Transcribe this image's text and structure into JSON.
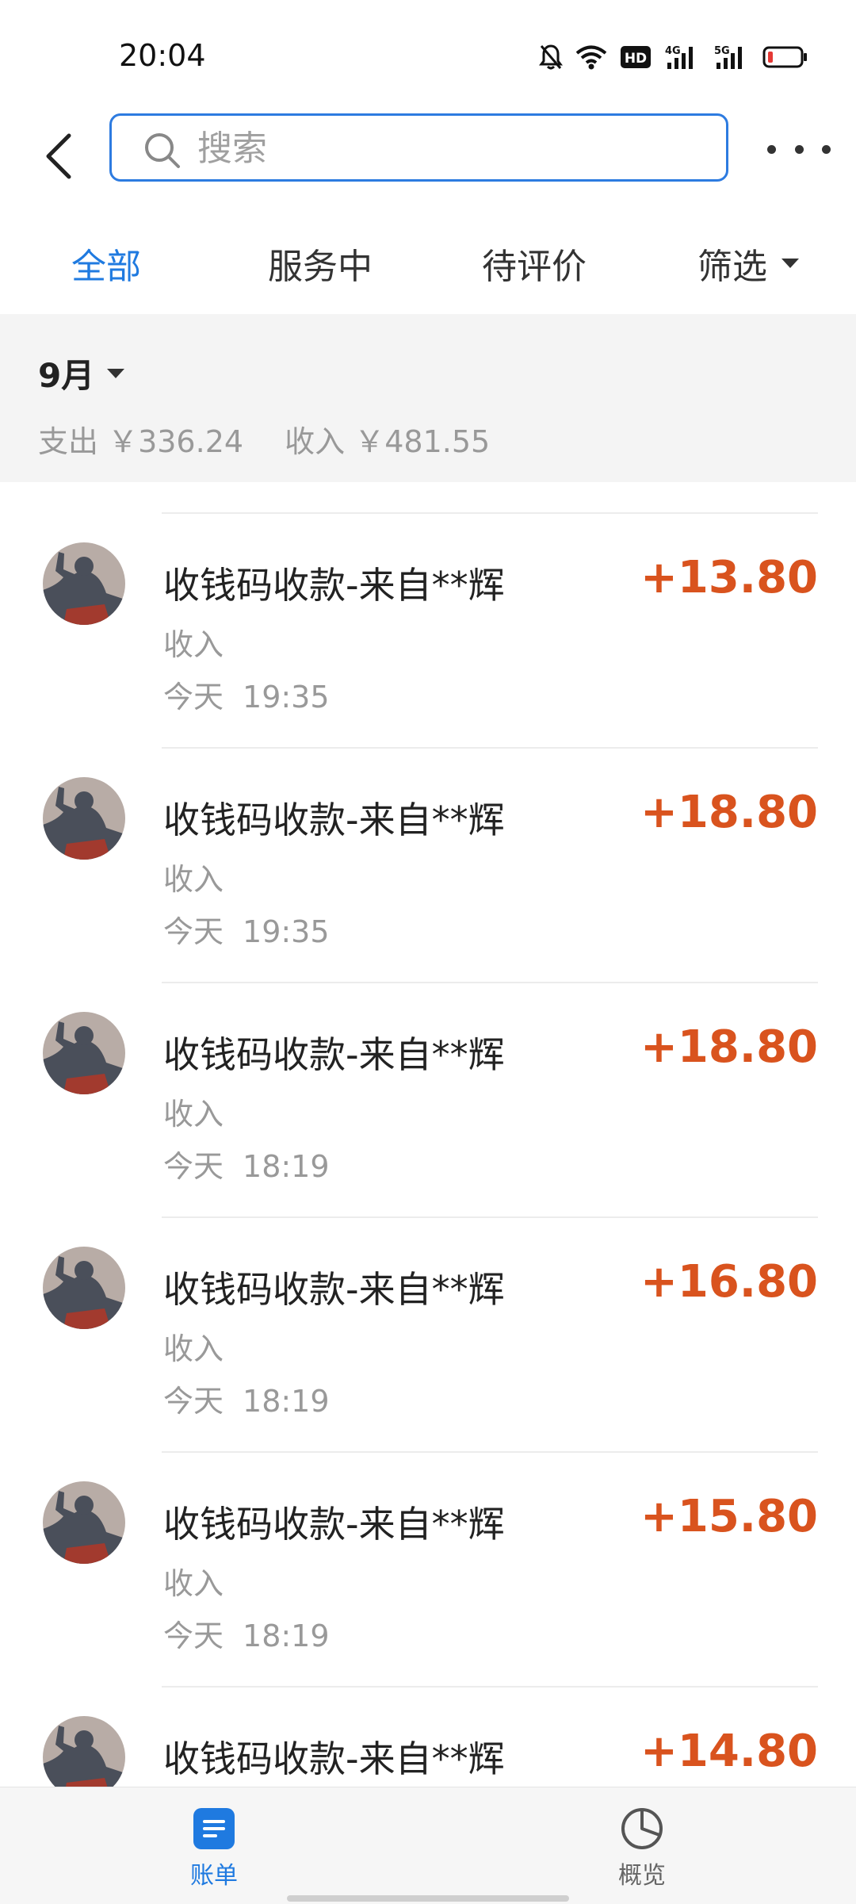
{
  "status_bar": {
    "time": "20:04",
    "icons": [
      "mute-bell-icon",
      "wifi-icon",
      "hd-icon",
      "signal-4g-icon",
      "signal-5g-icon",
      "battery-low-icon"
    ],
    "hd_label": "HD",
    "net_4g": "4G",
    "net_5g": "5G"
  },
  "header": {
    "search_placeholder": "搜索"
  },
  "tabs": {
    "all": "全部",
    "serving": "服务中",
    "pending_review": "待评价",
    "filter": "筛选"
  },
  "month": {
    "label": "9月",
    "expense": "支出 ￥336.24",
    "income": "收入 ￥481.55"
  },
  "transactions": [
    {
      "title": "收钱码收款-来自**辉",
      "type": "收入",
      "day": "今天",
      "time": "19:35",
      "amount": "+13.80"
    },
    {
      "title": "收钱码收款-来自**辉",
      "type": "收入",
      "day": "今天",
      "time": "19:35",
      "amount": "+18.80"
    },
    {
      "title": "收钱码收款-来自**辉",
      "type": "收入",
      "day": "今天",
      "time": "18:19",
      "amount": "+18.80"
    },
    {
      "title": "收钱码收款-来自**辉",
      "type": "收入",
      "day": "今天",
      "time": "18:19",
      "amount": "+16.80"
    },
    {
      "title": "收钱码收款-来自**辉",
      "type": "收入",
      "day": "今天",
      "time": "18:19",
      "amount": "+15.80"
    },
    {
      "title": "收钱码收款-来自**辉",
      "type": "收入",
      "day": "",
      "time": "",
      "amount": "+14.80"
    }
  ],
  "bottom_nav": {
    "bills": "账单",
    "overview": "概览"
  },
  "colors": {
    "accent": "#1f7ae0",
    "amount": "#d9531e",
    "secondary_text": "#999999"
  }
}
